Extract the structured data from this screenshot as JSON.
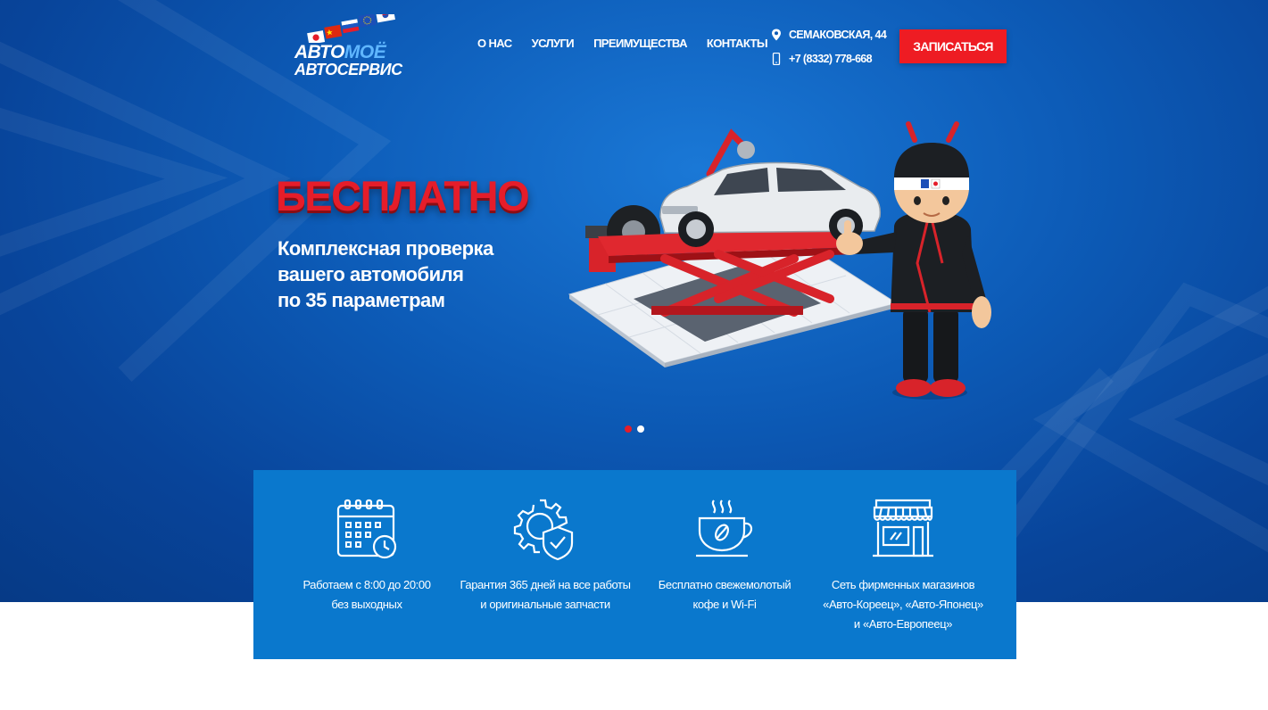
{
  "brand": {
    "logo_part1": "АВТО",
    "logo_part2": "МОЁ",
    "logo_line2": "АВТОСЕРВИС"
  },
  "nav": {
    "items": [
      {
        "label": "О НАС"
      },
      {
        "label": "УСЛУГИ"
      },
      {
        "label": "ПРЕИМУЩЕСТВА"
      },
      {
        "label": "КОНТАКТЫ"
      }
    ]
  },
  "contact": {
    "address": "СЕМАКОВСКАЯ, 44",
    "address_icon": "location-pin-icon",
    "phone": "+7 (8332) 778-668",
    "phone_icon": "mobile-phone-icon"
  },
  "cta": {
    "label": "ЗАПИСАТЬСЯ"
  },
  "slide": {
    "title": "БЕСПЛАТНО",
    "lines": [
      "Комплексная проверка",
      "вашего автомобиля",
      "по 35 параметрам"
    ],
    "current": 1,
    "total": 2
  },
  "features": [
    {
      "icon": "calendar-clock-icon",
      "lines": [
        "Работаем с 8:00 до 20:00",
        "без выходных"
      ]
    },
    {
      "icon": "gear-shield-icon",
      "lines": [
        "Гарантия 365 дней на все работы",
        "и оригинальные запчасти"
      ]
    },
    {
      "icon": "coffee-cup-icon",
      "lines": [
        "Бесплатно свежемолотый",
        "кофе и Wi-Fi"
      ]
    },
    {
      "icon": "storefront-icon",
      "lines": [
        "Сеть фирменных магазинов",
        "«Авто-Кореец», «Авто-Японец»",
        "и «Авто-Европеец»"
      ]
    }
  ],
  "colors": {
    "accent_red": "#ee1c23",
    "hero_blue": "#0d5cb8",
    "features_blue": "#0a78cd",
    "logo_blue": "#5fb6ff"
  }
}
